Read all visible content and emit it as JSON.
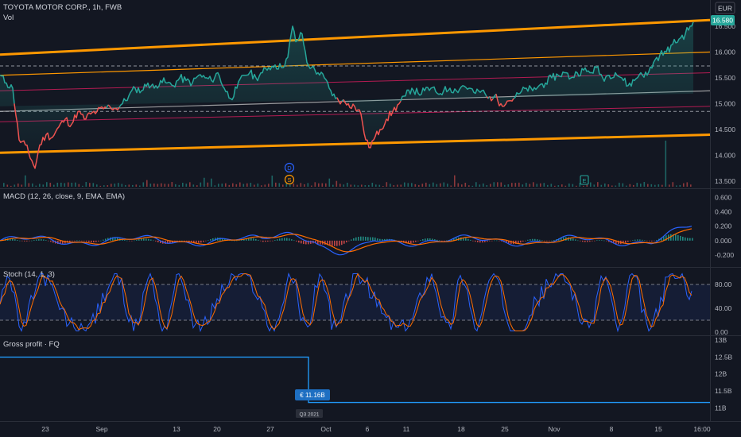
{
  "header": {
    "symbol_line": "TOYOTA MOTOR CORP., 1h, FWB",
    "vol_label": "Vol",
    "currency": "EUR",
    "last_price": "16.580"
  },
  "panes": {
    "macd_label": "MACD (12, 26, close, 9, EMA, EMA)",
    "stoch_label": "Stoch (14, 1, 3)",
    "gross_label": "Gross profit · FQ"
  },
  "axes": {
    "price_ticks": [
      "16.500",
      "16.000",
      "15.500",
      "15.000",
      "14.500",
      "14.000",
      "13.500"
    ],
    "macd_ticks": [
      "0.600",
      "0.400",
      "0.200",
      "0.000",
      "-0.200"
    ],
    "stoch_ticks": [
      "80.00",
      "40.00",
      "0.00"
    ],
    "gross_ticks": [
      "13B",
      "12.5B",
      "12B",
      "11.5B",
      "11B"
    ],
    "time_ticks": [
      "23",
      "Sep",
      "13",
      "20",
      "27",
      "Oct",
      "6",
      "11",
      "18",
      "25",
      "Nov",
      "8",
      "15",
      "16:00"
    ]
  },
  "markers": {
    "dividend": "D",
    "split": "S",
    "earnings": "E",
    "gross_value_tag": "€ 11.16B",
    "quarter_tag": "Q3 2021"
  },
  "colors": {
    "background": "#131722",
    "up": "#26a69a",
    "down": "#ef5350",
    "channel": "#ff9800",
    "macd_line": "#2962ff",
    "signal_line": "#ff6d00",
    "stoch_k": "#2962ff",
    "stoch_d": "#ff6d00",
    "gross_line": "#2196f3"
  },
  "chart_data": {
    "type": "line",
    "title": "TOYOTA MOTOR CORP., 1h, FWB",
    "currency": "EUR",
    "last_price": 16.58,
    "price_ylim": [
      13.5,
      16.7
    ],
    "price_path": [
      [
        0,
        15.55
      ],
      [
        8,
        15.4
      ],
      [
        16,
        15.3
      ],
      [
        24,
        14.3
      ],
      [
        32,
        14.2
      ],
      [
        40,
        13.9
      ],
      [
        44,
        13.75
      ],
      [
        50,
        14.2
      ],
      [
        58,
        14.4
      ],
      [
        66,
        14.35
      ],
      [
        74,
        14.55
      ],
      [
        82,
        14.7
      ],
      [
        90,
        14.6
      ],
      [
        98,
        14.85
      ],
      [
        106,
        14.7
      ],
      [
        114,
        14.8
      ],
      [
        122,
        14.85
      ],
      [
        130,
        14.9
      ],
      [
        138,
        14.95
      ],
      [
        146,
        14.9
      ],
      [
        154,
        15.0
      ],
      [
        162,
        15.15
      ],
      [
        170,
        15.3
      ],
      [
        178,
        15.25
      ],
      [
        186,
        15.4
      ],
      [
        194,
        15.3
      ],
      [
        202,
        15.45
      ],
      [
        210,
        15.4
      ],
      [
        218,
        15.35
      ],
      [
        226,
        15.5
      ],
      [
        234,
        15.45
      ],
      [
        242,
        15.4
      ],
      [
        250,
        15.55
      ],
      [
        258,
        15.5
      ],
      [
        266,
        15.45
      ],
      [
        274,
        15.6
      ],
      [
        282,
        15.3
      ],
      [
        290,
        15.1
      ],
      [
        298,
        15.3
      ],
      [
        306,
        15.55
      ],
      [
        314,
        15.6
      ],
      [
        322,
        15.5
      ],
      [
        330,
        15.6
      ],
      [
        338,
        15.7
      ],
      [
        346,
        15.75
      ],
      [
        354,
        15.7
      ],
      [
        362,
        15.9
      ],
      [
        368,
        16.5
      ],
      [
        372,
        16.2
      ],
      [
        380,
        16.35
      ],
      [
        386,
        15.8
      ],
      [
        392,
        15.7
      ],
      [
        400,
        15.6
      ],
      [
        408,
        15.5
      ],
      [
        414,
        15.3
      ],
      [
        422,
        15.1
      ],
      [
        430,
        15.05
      ],
      [
        438,
        15.0
      ],
      [
        446,
        14.95
      ],
      [
        454,
        14.8
      ],
      [
        460,
        14.3
      ],
      [
        464,
        14.15
      ],
      [
        470,
        14.3
      ],
      [
        478,
        14.5
      ],
      [
        486,
        14.7
      ],
      [
        494,
        14.85
      ],
      [
        502,
        15.0
      ],
      [
        510,
        15.15
      ],
      [
        518,
        15.3
      ],
      [
        526,
        15.2
      ],
      [
        534,
        15.25
      ],
      [
        542,
        15.3
      ],
      [
        550,
        15.2
      ],
      [
        558,
        15.25
      ],
      [
        566,
        15.3
      ],
      [
        574,
        15.25
      ],
      [
        582,
        15.35
      ],
      [
        590,
        15.3
      ],
      [
        598,
        15.2
      ],
      [
        606,
        15.25
      ],
      [
        614,
        15.1
      ],
      [
        622,
        15.15
      ],
      [
        630,
        15.0
      ],
      [
        638,
        15.05
      ],
      [
        646,
        15.1
      ],
      [
        654,
        15.2
      ],
      [
        662,
        15.3
      ],
      [
        670,
        15.25
      ],
      [
        678,
        15.35
      ],
      [
        686,
        15.4
      ],
      [
        694,
        15.5
      ],
      [
        702,
        15.55
      ],
      [
        710,
        15.6
      ],
      [
        718,
        15.5
      ],
      [
        726,
        15.6
      ],
      [
        734,
        15.65
      ],
      [
        742,
        15.6
      ],
      [
        750,
        15.7
      ],
      [
        758,
        15.5
      ],
      [
        766,
        15.55
      ],
      [
        774,
        15.6
      ],
      [
        782,
        15.5
      ],
      [
        790,
        15.35
      ],
      [
        798,
        15.45
      ],
      [
        806,
        15.6
      ],
      [
        814,
        15.55
      ],
      [
        822,
        15.8
      ],
      [
        830,
        15.95
      ],
      [
        838,
        16.0
      ],
      [
        846,
        16.15
      ],
      [
        854,
        16.25
      ],
      [
        862,
        16.35
      ],
      [
        868,
        16.5
      ],
      [
        872,
        16.58
      ]
    ],
    "channel": {
      "upper_outer": [
        [
          0,
          15.95
        ],
        [
          893,
          16.62
        ]
      ],
      "upper_inner": [
        [
          0,
          15.55
        ],
        [
          893,
          16.0
        ]
      ],
      "mid_upper": [
        [
          0,
          15.25
        ],
        [
          893,
          15.6
        ]
      ],
      "mid": [
        [
          0,
          14.85
        ],
        [
          893,
          15.25
        ]
      ],
      "mid_lower": [
        [
          0,
          14.65
        ],
        [
          893,
          14.95
        ]
      ],
      "lower_outer": [
        [
          0,
          14.05
        ],
        [
          893,
          14.4
        ]
      ]
    },
    "dashed_levels": [
      15.73,
      14.85
    ],
    "macd": {
      "ylim": [
        -0.3,
        0.65
      ],
      "ticks": [
        0.6,
        0.4,
        0.2,
        0.0,
        -0.2
      ]
    },
    "stoch": {
      "ylim": [
        0,
        100
      ],
      "bands": [
        80,
        20
      ],
      "ticks": [
        80,
        40,
        0
      ]
    },
    "gross_profit": {
      "ylim": [
        10.8,
        13.0
      ],
      "steps": [
        [
          0,
          12.5
        ],
        [
          388,
          12.5
        ],
        [
          388,
          11.16
        ],
        [
          893,
          11.16
        ]
      ],
      "label": "€ 11.16B",
      "quarter": "Q3 2021"
    }
  }
}
